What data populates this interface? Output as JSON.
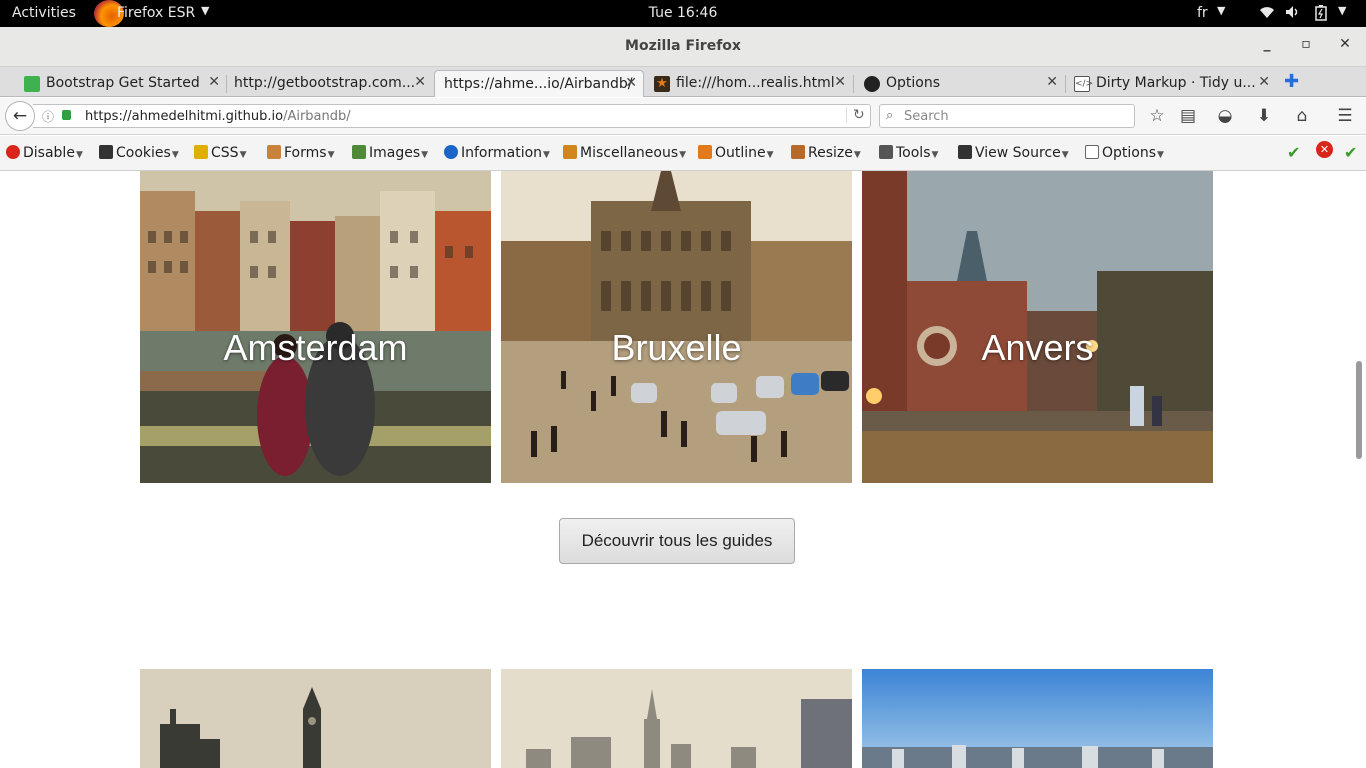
{
  "system": {
    "activities": "Activities",
    "app_name": "Firefox ESR",
    "clock": "Tue 16:46",
    "language": "fr"
  },
  "window": {
    "title": "Mozilla Firefox"
  },
  "tabs": [
    {
      "label": "Bootstrap Get Started",
      "icon": "bootstrap-icon",
      "color": "#3fb24f"
    },
    {
      "label": "http://getbootstrap.com...",
      "icon": "none"
    },
    {
      "label": "https://ahme...io/Airbandb/",
      "icon": "none",
      "active": true
    },
    {
      "label": "file:///hom...realis.html",
      "icon": "star-icon",
      "color": "#e57a1a"
    },
    {
      "label": "Options",
      "icon": "github-icon",
      "color": "#222222"
    },
    {
      "label": "Dirty Markup · Tidy u...",
      "icon": "code-icon",
      "color": "#555555"
    }
  ],
  "navbar": {
    "url_host": "https://ahmedelhitmi.github.io",
    "url_path": "/Airbandb/",
    "search_placeholder": "Search"
  },
  "devtoolbar": {
    "items": [
      {
        "label": "Disable",
        "icon_color": "#d9261c"
      },
      {
        "label": "Cookies",
        "icon_color": "#333333"
      },
      {
        "label": "CSS",
        "icon_color": "#e0b000"
      },
      {
        "label": "Forms",
        "icon_color": "#c8823a"
      },
      {
        "label": "Images",
        "icon_color": "#4f8a3a"
      },
      {
        "label": "Information",
        "icon_color": "#1b64c8"
      },
      {
        "label": "Miscellaneous",
        "icon_color": "#d1861d"
      },
      {
        "label": "Outline",
        "icon_color": "#e07a1a"
      },
      {
        "label": "Resize",
        "icon_color": "#b56a2a"
      },
      {
        "label": "Tools",
        "icon_color": "#555555"
      },
      {
        "label": "View Source",
        "icon_color": "#333333"
      },
      {
        "label": "Options",
        "icon_color": "#666666"
      }
    ]
  },
  "page": {
    "cities": [
      {
        "name": "Amsterdam"
      },
      {
        "name": "Bruxelle"
      },
      {
        "name": "Anvers"
      }
    ],
    "discover_button": "Découvrir tous les guides"
  },
  "colors": {
    "check_green": "#3a9b2a",
    "error_red": "#d9261c",
    "accent_blue": "#2a6cd6"
  }
}
